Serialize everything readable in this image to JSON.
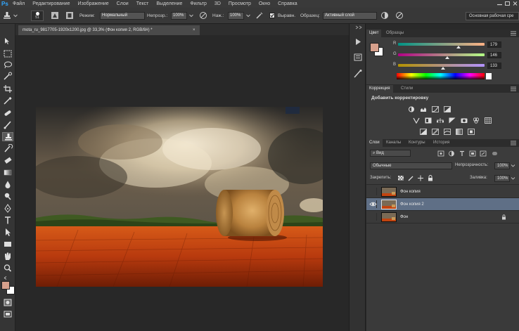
{
  "app": {
    "logo": "Ps",
    "menu": [
      "Файл",
      "Редактирование",
      "Изображение",
      "Слои",
      "Текст",
      "Выделение",
      "Фильтр",
      "3D",
      "Просмотр",
      "Окно",
      "Справка"
    ]
  },
  "options_bar": {
    "brush_size": "51",
    "mode_label": "Режим:",
    "mode_value": "Нормальный",
    "opacity_label": "Непрозр.:",
    "opacity_value": "100%",
    "flow_label": "Наж.:",
    "flow_value": "100%",
    "aligned_label": "Выравн.",
    "aligned_checked": true,
    "sample_label": "Образец:",
    "sample_value": "Активный слой",
    "workspace": "Основная рабочая сре"
  },
  "document": {
    "tab_title": "mota_ru_9817705-1920x1200.jpg @ 33,3% (Фон копия 2, RGB/8#) *",
    "close": "×"
  },
  "color_panel": {
    "tabs": [
      "Цвет",
      "Образцы"
    ],
    "foreground_color": "#d6a08c",
    "channels": [
      {
        "label": "R",
        "value": "179",
        "level": 0.7
      },
      {
        "label": "G",
        "value": "146",
        "level": 0.57
      },
      {
        "label": "B",
        "value": "133",
        "level": 0.52
      }
    ]
  },
  "adjustments_panel": {
    "tabs": [
      "Коррекция",
      "Стили"
    ],
    "title": "Добавить корректировку"
  },
  "layers_panel": {
    "tabs": [
      "Слои",
      "Каналы",
      "Контуры",
      "История"
    ],
    "filter_kind": "Вид",
    "blend_mode": "Обычные",
    "opacity_label": "Непрозрачность:",
    "opacity_value": "100%",
    "lock_label": "Закрепить:",
    "fill_label": "Заливка:",
    "fill_value": "100%",
    "layers": [
      {
        "name": "Фон копия",
        "visible": false,
        "selected": false,
        "locked": false
      },
      {
        "name": "Фон копия 2",
        "visible": true,
        "selected": true,
        "locked": false
      },
      {
        "name": "Фон",
        "visible": false,
        "selected": false,
        "locked": true
      }
    ]
  },
  "colors": {
    "accent": "#31a8ff",
    "selected_layer": "#5f6f86",
    "background_swatch": "#ffffff"
  }
}
